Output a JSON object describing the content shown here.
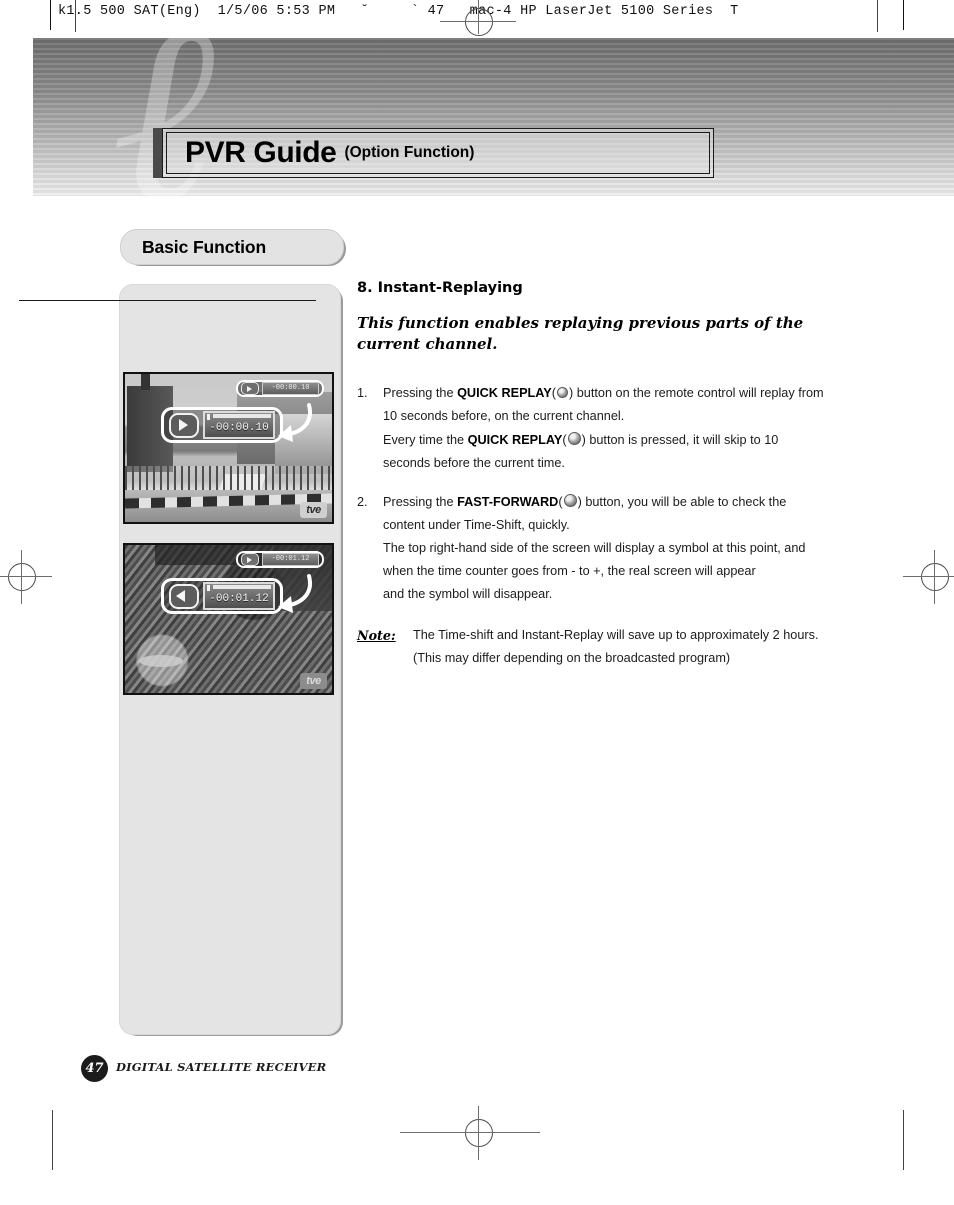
{
  "print_slug": "k1.5 500 SAT(Eng)  1/5/06 5:53 PM   ˘     ` 47   mac-4 HP LaserJet 5100 Series  T",
  "banner": {
    "watermark_glyph": "ℓ",
    "title_main": "PVR Guide",
    "title_sub": "(Option Function)"
  },
  "section_tab": {
    "label": "Basic Function"
  },
  "section": {
    "number": "8.",
    "heading": "Instant-Replaying",
    "intro": "This function enables replaying previous parts of the current channel."
  },
  "steps": [
    {
      "marker": "1.",
      "lines": [
        {
          "pre": "Pressing the ",
          "bold": "QUICK REPLAY",
          "mid": "(",
          "icon": "remote-button-icon",
          "post": ") button on the remote control will replay from"
        },
        {
          "pre": "10 seconds before, on the current channel.",
          "bold": "",
          "mid": "",
          "icon": "",
          "post": ""
        },
        {
          "pre": "Every time the ",
          "bold": "QUICK REPLAY",
          "mid": "(",
          "icon": "remote-button-icon",
          "post": ") button is pressed, it will skip to 10"
        },
        {
          "pre": "seconds before the current time.",
          "bold": "",
          "mid": "",
          "icon": "",
          "post": ""
        }
      ]
    },
    {
      "marker": "2.",
      "lines": [
        {
          "pre": "Pressing the ",
          "bold": "FAST-FORWARD",
          "mid": "(",
          "icon": "remote-button-icon",
          "post": ") button, you will be able to check the"
        },
        {
          "pre": "content under Time-Shift, quickly.",
          "bold": "",
          "mid": "",
          "icon": "",
          "post": ""
        },
        {
          "pre": "The top right-hand side of the screen will display a symbol at this point, and",
          "bold": "",
          "mid": "",
          "icon": "",
          "post": ""
        },
        {
          "pre": "when the time counter goes from - to +, the real screen will appear",
          "bold": "",
          "mid": "",
          "icon": "",
          "post": ""
        },
        {
          "pre": "and the symbol will disappear.",
          "bold": "",
          "mid": "",
          "icon": "",
          "post": ""
        }
      ]
    }
  ],
  "note": {
    "label": "Note:",
    "lines": [
      "The Time-shift and Instant-Replay will save up to approximately 2 hours.",
      "(This may differ depending on the broadcasted program)"
    ]
  },
  "screenshots": [
    {
      "name": "instant-replay-city-scene",
      "osd_small_counter": "-00:00.10",
      "osd_big_counter": "-00:00.10",
      "channel_logo": "tve",
      "transport_icon": "play-icon"
    },
    {
      "name": "fast-forward-grass-scene",
      "osd_small_counter": "-00:01.12",
      "osd_big_counter": "-00:01.12",
      "channel_logo": "tve",
      "transport_icon": "rewind-icon"
    }
  ],
  "footer": {
    "page_number": "47",
    "product_line": "DIGITAL SATELLITE RECEIVER"
  },
  "colors": {
    "panel_bg": "#e4e4e4",
    "pill_bg": "#e3e3e3",
    "ink": "#1c1c1c",
    "badge_bg": "#1b1b1b"
  }
}
